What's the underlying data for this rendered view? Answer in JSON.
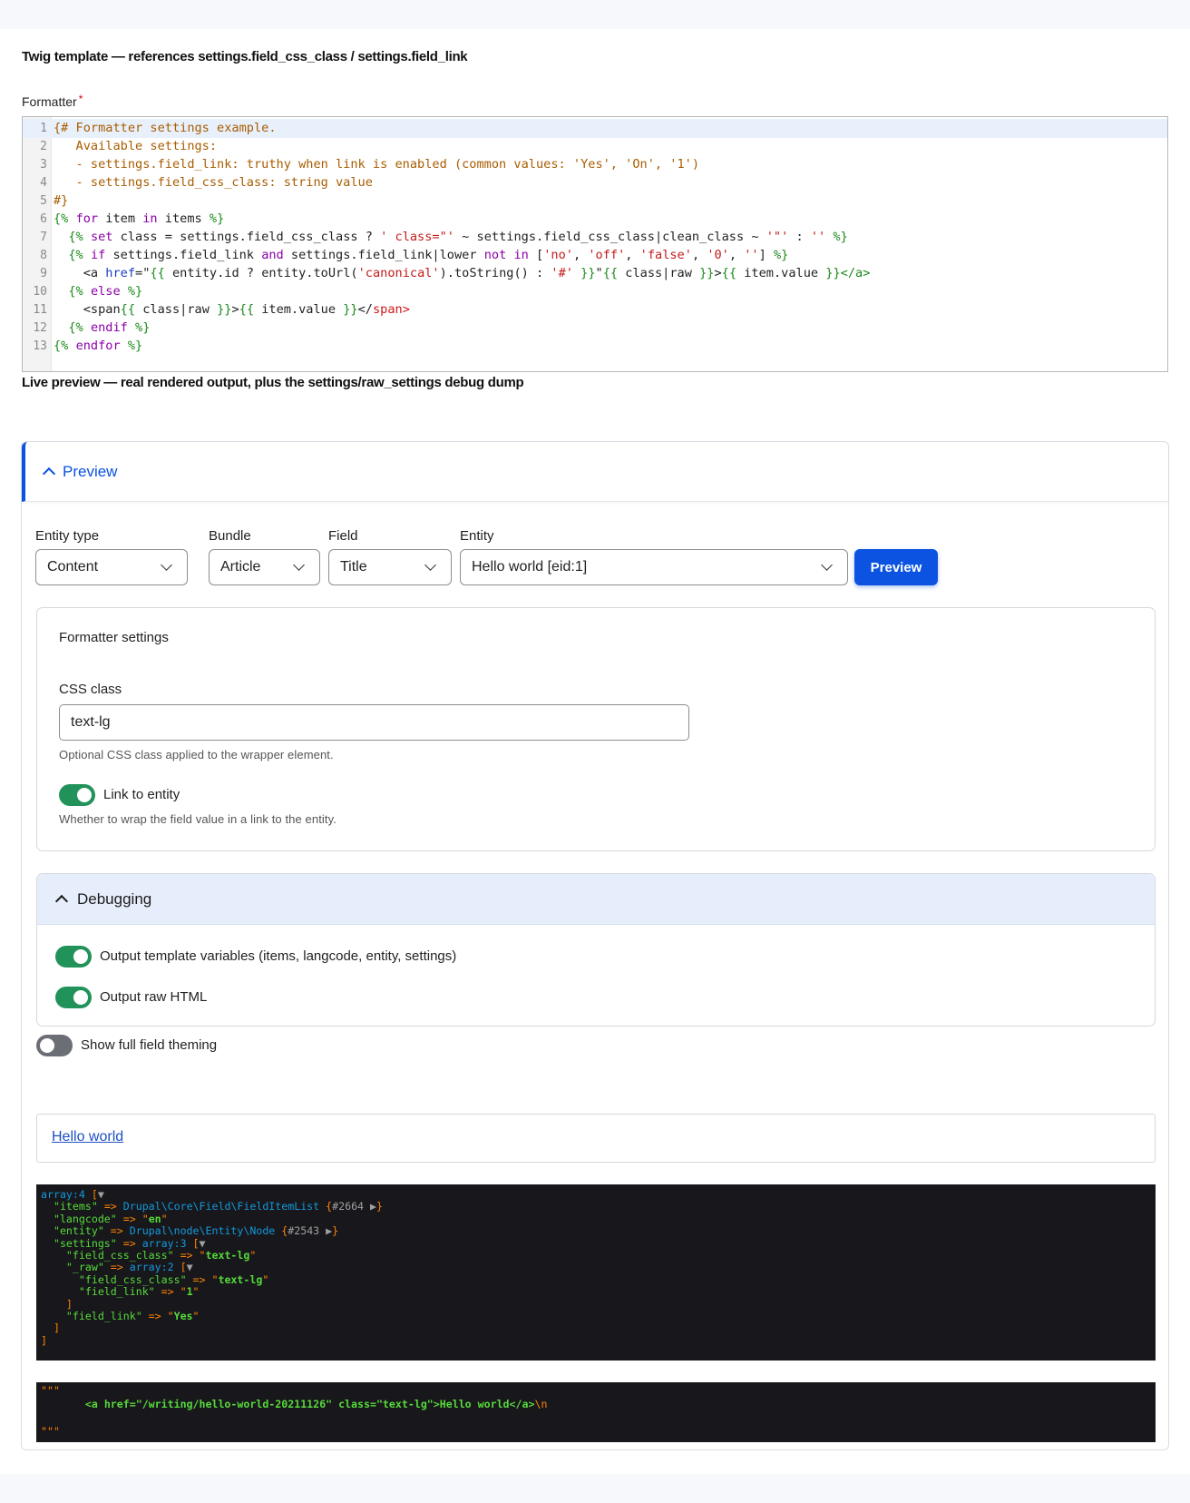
{
  "headings": {
    "twig": "Twig template — references settings.field_css_class / settings.field_link",
    "live": "Live preview — real rendered output, plus the settings/raw_settings debug dump"
  },
  "formatter_label": "Formatter",
  "required_mark": "*",
  "code_lines": [
    {
      "n": "1",
      "html": "<span class=\"t-cm\">{# Formatter settings example.</span>"
    },
    {
      "n": "2",
      "html": "<span class=\"t-cm\">   Available settings:</span>"
    },
    {
      "n": "3",
      "html": "<span class=\"t-cm\">   - settings.field_link: truthy when link is enabled (common values: 'Yes', 'On', '1')</span>"
    },
    {
      "n": "4",
      "html": "<span class=\"t-cm\">   - settings.field_css_class: string value</span>"
    },
    {
      "n": "5",
      "html": "<span class=\"t-cm\">#}</span>"
    },
    {
      "n": "6",
      "html": "<span class=\"t-dl\">{%</span> <span class=\"t-kw\">for</span> item <span class=\"t-kw\">in</span> items <span class=\"t-dl\">%}</span>"
    },
    {
      "n": "7",
      "html": "  <span class=\"t-dl\">{%</span> <span class=\"t-kw\">set</span> class = settings.field_css_class ? <span class=\"t-st\">' class=\"'</span> ~ settings.field_css_class|clean_class ~ <span class=\"t-st\">'\"'</span> : <span class=\"t-st\">''</span> <span class=\"t-dl\">%}</span>"
    },
    {
      "n": "8",
      "html": "  <span class=\"t-dl\">{%</span> <span class=\"t-kw\">if</span> settings.field_link <span class=\"t-kw\">and</span> settings.field_link|lower <span class=\"t-kw\">not in</span> [<span class=\"t-st\">'no'</span>, <span class=\"t-st\">'off'</span>, <span class=\"t-st\">'false'</span>, <span class=\"t-st\">'0'</span>, <span class=\"t-st\">''</span>] <span class=\"t-dl\">%}</span>"
    },
    {
      "n": "9",
      "html": "    &lt;a <span class=\"t-at\">href</span>=\"<span class=\"t-dl\">{{</span> entity.id ? entity.toUrl(<span class=\"t-st\">'canonical'</span>).toString() : <span class=\"t-st\">'#'</span> <span class=\"t-dl\">}}</span>\"<span class=\"t-dl\">{{</span> class|raw <span class=\"t-dl\">}}</span>&gt;<span class=\"t-dl\">{{</span> item.value <span class=\"t-dl\">}}</span><span class=\"t-tg\">&lt;/a&gt;</span>"
    },
    {
      "n": "10",
      "html": "  <span class=\"t-dl\">{%</span> <span class=\"t-kw\">else</span> <span class=\"t-dl\">%}</span>"
    },
    {
      "n": "11",
      "html": "    &lt;span<span class=\"t-dl\">{{</span> class|raw <span class=\"t-dl\">}}</span>&gt;<span class=\"t-dl\">{{</span> item.value <span class=\"t-dl\">}}</span>&lt;/<span class=\"t-tr\">span&gt;</span>"
    },
    {
      "n": "12",
      "html": "  <span class=\"t-dl\">{%</span> <span class=\"t-kw\">endif</span> <span class=\"t-dl\">%}</span>"
    },
    {
      "n": "13",
      "html": "<span class=\"t-dl\">{%</span> <span class=\"t-kw\">endfor</span> <span class=\"t-dl\">%}</span>"
    }
  ],
  "preview_section": {
    "title": "Preview",
    "entity_type": {
      "label": "Entity type",
      "value": "Content"
    },
    "bundle": {
      "label": "Bundle",
      "value": "Article"
    },
    "field": {
      "label": "Field",
      "value": "Title"
    },
    "entity": {
      "label": "Entity",
      "value": "Hello world [eid:1]"
    },
    "button_label": "Preview"
  },
  "formatter_settings": {
    "title": "Formatter settings",
    "css_class_label": "CSS class",
    "css_class_value": "text-lg",
    "css_class_help": "Optional CSS class applied to the wrapper element.",
    "link_label": "Link to entity",
    "link_on": true,
    "link_help": "Whether to wrap the field value in a link to the entity."
  },
  "debugging": {
    "title": "Debugging",
    "output_vars_label": "Output template variables (items, langcode, entity, settings)",
    "output_vars_on": true,
    "output_raw_label": "Output raw HTML",
    "output_raw_on": true
  },
  "full_theming": {
    "label": "Show full field theming",
    "on": false
  },
  "rendered_link": "Hello world",
  "dump_lines": [
    "<span class=\"d-c\">array:4</span> [<span class=\"d-g\">▼</span>",
    "  <span class=\"d-k\">\"items\"</span> => <span class=\"d-c\">Drupal\\Core\\Field\\FieldItemList</span> {<span class=\"d-g\">#2664 ▶</span>}",
    "  <span class=\"d-k\">\"langcode\"</span> => \"<span class=\"d-s\">en</span>\"",
    "  <span class=\"d-k\">\"entity\"</span> => <span class=\"d-c\">Drupal\\node\\Entity\\Node</span> {<span class=\"d-g\">#2543 ▶</span>}",
    "  <span class=\"d-k\">\"settings\"</span> => <span class=\"d-c\">array:3</span> [<span class=\"d-g\">▼</span>",
    "    <span class=\"d-k\">\"field_css_class\"</span> => \"<span class=\"d-s\">text-lg</span>\"",
    "    <span class=\"d-k\">\"_raw\"</span> => <span class=\"d-c\">array:2</span> [<span class=\"d-g\">▼</span>",
    "      <span class=\"d-k\">\"field_css_class\"</span> => \"<span class=\"d-s\">text-lg</span>\"",
    "      <span class=\"d-k\">\"field_link\"</span> => \"<span class=\"d-s\">1</span>\"",
    "    ]",
    "    <span class=\"d-k\">\"field_link\"</span> => \"<span class=\"d-s\">Yes</span>\"",
    "  ]",
    "]"
  ],
  "raw_html_lines": [
    "\"\"\"",
    "       <span class=\"d-s\">&lt;a href=\"/writing/hello-world-20211126\" class=\"text-lg\"&gt;Hello world&lt;/a&gt;</span>\\n",
    "",
    "\"\"\""
  ]
}
